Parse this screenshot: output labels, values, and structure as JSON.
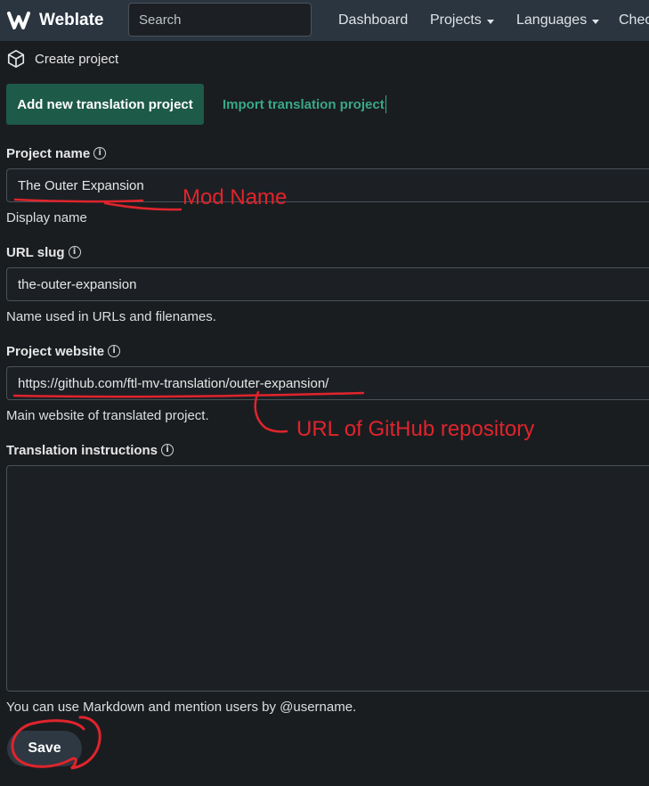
{
  "navbar": {
    "brand": "Weblate",
    "search_placeholder": "Search",
    "items": [
      {
        "label": "Dashboard"
      },
      {
        "label": "Projects"
      },
      {
        "label": "Languages"
      },
      {
        "label": "Chec"
      }
    ]
  },
  "breadcrumb": {
    "label": "Create project"
  },
  "tabs": {
    "active": "Add new translation project",
    "other": "Import translation project"
  },
  "form": {
    "project_name": {
      "label": "Project name",
      "value": "The Outer Expansion",
      "help": "Display name"
    },
    "url_slug": {
      "label": "URL slug",
      "value": "the-outer-expansion",
      "help": "Name used in URLs and filenames."
    },
    "project_website": {
      "label": "Project website",
      "value": "https://github.com/ftl-mv-translation/outer-expansion/",
      "help": "Main website of translated project."
    },
    "instructions": {
      "label": "Translation instructions",
      "value": "",
      "help": "You can use Markdown and mention users by @username."
    },
    "save_label": "Save"
  },
  "annotations": {
    "mod_name": "Mod Name",
    "repo_url": "URL of GitHub repository",
    "color": "#e0242c"
  },
  "colors": {
    "navbar_bg": "#2a3540",
    "page_bg": "#1a1d20",
    "accent_button": "#1e5a48",
    "accent_link": "#39a887"
  }
}
